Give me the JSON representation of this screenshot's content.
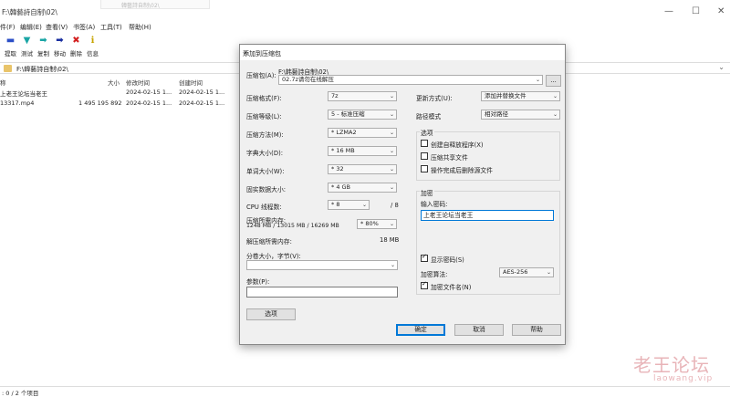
{
  "window": {
    "title": "F:\\韓藝詩自制\\02\\",
    "ghost_tab": "韓藝詩自制\\02\\",
    "minimize": "—",
    "maximize": "☐",
    "close": "✕"
  },
  "menu": [
    "件(F)",
    "编辑(E)",
    "查看(V)",
    "书签(A)",
    "工具(T)",
    "帮助(H)"
  ],
  "toolbar": [
    {
      "label": "提取",
      "icon": "minus-icon",
      "glyph": "▬",
      "color": "#2b4fc7"
    },
    {
      "label": "测试",
      "icon": "check-arrow-icon",
      "glyph": "▼",
      "color": "#1aa5a5"
    },
    {
      "label": "复制",
      "icon": "copy-arrow-icon",
      "glyph": "➡",
      "color": "#1aa5a5"
    },
    {
      "label": "移动",
      "icon": "move-arrow-icon",
      "glyph": "➡",
      "color": "#1a2fa0"
    },
    {
      "label": "删除",
      "icon": "delete-x-icon",
      "glyph": "✖",
      "color": "#d32020"
    },
    {
      "label": "信息",
      "icon": "info-icon",
      "glyph": "ℹ",
      "color": "#c7a400"
    }
  ],
  "address": "F:\\韓藝詩自制\\02\\",
  "columns": {
    "name": "称",
    "size": "大小",
    "modified": "修改时间",
    "created": "创建时间"
  },
  "files": [
    {
      "name": "上老王论坛当老王",
      "size": "",
      "modified": "2024-02-15 1...",
      "created": "2024-02-15 1..."
    },
    {
      "name": "13317.mp4",
      "size": "1 495 195 892",
      "modified": "2024-02-15 1...",
      "created": "2024-02-15 1..."
    }
  ],
  "status": ": 0 / 2 个项目",
  "watermark": {
    "cn": "老王论坛",
    "en": "laowang.vip"
  },
  "dialog": {
    "title": "添加到压缩包",
    "archive_label": "压缩包(A):",
    "archive_dir": "F:\\韩藝詩自制\\02\\",
    "archive_name": "02.7z请勿在线解压",
    "browse": "...",
    "format_label": "压缩格式(F):",
    "format_value": "7z",
    "level_label": "压缩等级(L):",
    "level_value": "5 - 标准压缩",
    "method_label": "压缩方法(M):",
    "method_value": "* LZMA2",
    "dict_label": "字典大小(D):",
    "dict_value": "* 16 MB",
    "word_label": "单词大小(W):",
    "word_value": "* 32",
    "solid_label": "固实数据大小:",
    "solid_value": "* 4 GB",
    "threads_label": "CPU 线程数:",
    "threads_value": "* 8",
    "threads_total": "/ 8",
    "mem_label": "压缩所需内存:",
    "mem_value": "1248 MB / 13015 MB / 16269 MB",
    "mem_percent": "* 80%",
    "decomp_label": "解压缩所需内存:",
    "decomp_value": "18 MB",
    "split_label": "分卷大小，字节(V):",
    "params_label": "参数(P):",
    "options_button": "选项",
    "update_label": "更新方式(U):",
    "update_value": "添加并替换文件",
    "path_label": "路径模式",
    "path_value": "相对路径",
    "options_group": "选项",
    "opt_sfx": "创建自释放程序(X)",
    "opt_shared": "压缩共享文件",
    "opt_delete": "操作完成后删除源文件",
    "enc_group": "加密",
    "password_label": "输入密码:",
    "password_value": "上老王论坛当老王",
    "show_password": "显示密码(S)",
    "enc_method_label": "加密算法:",
    "enc_method_value": "AES-256",
    "enc_names": "加密文件名(N)",
    "ok": "确定",
    "cancel": "取消",
    "help": "帮助"
  }
}
